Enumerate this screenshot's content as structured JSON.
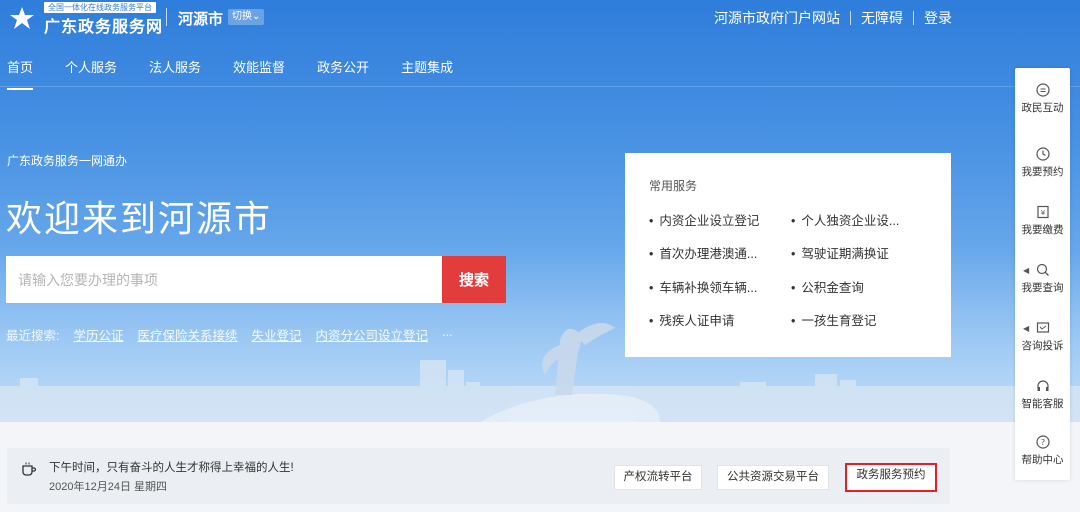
{
  "header": {
    "logo_sub": "全国一体化在线政务服务平台",
    "logo_main": "广东政务服务网",
    "city": "河源市",
    "switch_label": "切换",
    "links": [
      "河源市政府门户网站",
      "无障碍",
      "登录"
    ]
  },
  "nav": {
    "items": [
      "首页",
      "个人服务",
      "法人服务",
      "效能监督",
      "政务公开",
      "主题集成"
    ],
    "active_index": 0
  },
  "hero": {
    "tagline": "广东政务服务一网通办",
    "welcome": "欢迎来到河源市",
    "search_placeholder": "请输入您要办理的事项",
    "search_button": "搜索",
    "recent_label": "最近搜索:",
    "recent_items": [
      "学历公证",
      "医疗保险关系接续",
      "失业登记",
      "内资分公司设立登记",
      "..."
    ]
  },
  "common_services": {
    "title": "常用服务",
    "items": [
      "内资企业设立登记",
      "个人独资企业设...",
      "首次办理港澳通...",
      "驾驶证期满换证",
      "车辆补换领车辆...",
      "公积金查询",
      "残疾人证申请",
      "一孩生育登记"
    ]
  },
  "float_bar": {
    "items": [
      "政民互动",
      "我要预约",
      "我要缴费",
      "我要查询",
      "咨询投诉",
      "智能客服",
      "帮助中心"
    ]
  },
  "bottom": {
    "quote": "下午时间，只有奋斗的人生才称得上幸福的人生!",
    "date": "2020年12月24日 星期四",
    "buttons": [
      "产权流转平台",
      "公共资源交易平台",
      "政务服务预约"
    ]
  },
  "colors": {
    "brand_blue": "#2f7ddb",
    "search_red": "#e23c3c",
    "highlight_red": "#e2202a"
  }
}
